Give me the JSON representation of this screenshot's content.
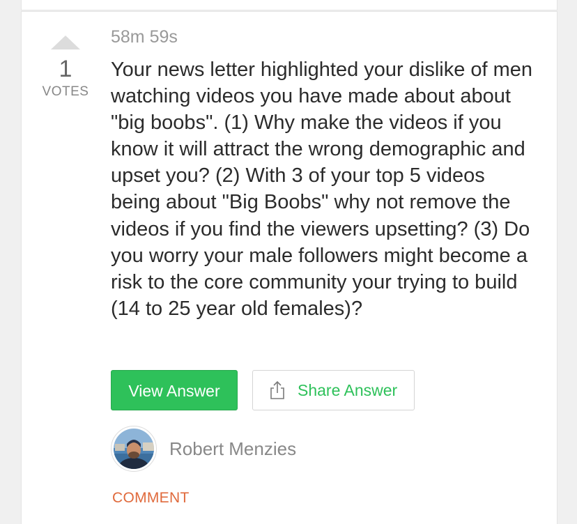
{
  "votes": {
    "count": "1",
    "label": "VOTES"
  },
  "question": {
    "timer": "58m 59s",
    "text": "Your news letter highlighted your dislike of men watching videos you have made about about \"big boobs\". (1) Why make the videos if you know it will attract the wrong demographic and upset you? (2) With 3 of your top 5 videos being about \"Big Boobs\" why not remove the videos if you find the viewers upsetting? (3) Do you worry your male followers might become a risk to the core community your trying to build (14 to 25 year old females)?"
  },
  "actions": {
    "view_answer_label": "View Answer",
    "share_answer_label": "Share Answer",
    "share_icon": "share-icon"
  },
  "author": {
    "name": "Robert Menzies",
    "avatar_icon": "avatar"
  },
  "comment_label": "COMMENT",
  "colors": {
    "accent_green": "#2ec15a",
    "comment_orange": "#e06a3c",
    "muted_text": "#888888",
    "body_text": "#2b2b2b"
  }
}
